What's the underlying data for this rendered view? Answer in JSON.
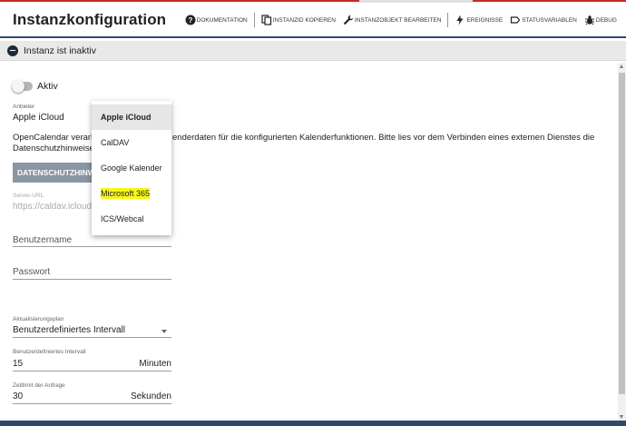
{
  "header": {
    "title": "Instanzkonfiguration",
    "toolbar": {
      "documentation": "Dokumentation",
      "copy_instance_id": "Instanzid kopieren",
      "edit_instance_object": "Instanzobjekt bearbeiten",
      "events": "Ereignisse",
      "status_variables": "Statusvariablen",
      "debug": "Debug"
    }
  },
  "section": {
    "label": "Instanz ist inaktiv"
  },
  "form": {
    "active": {
      "label": "Aktiv",
      "checked": false
    },
    "provider": {
      "label": "Anbieter",
      "value": "Apple iCloud"
    },
    "description_left": "OpenCalendar verarb",
    "description_right": "enderdaten für die konfigurierten Kalenderfunktionen. Bitte lies vor dem Verbinden eines externen Dienstes die",
    "description_line2": "Datenschutzhinweise",
    "privacy_button": "DATENSCHUTZHINW",
    "server_url": {
      "label": "Server-URL",
      "value": "https://caldav.icloud.c"
    },
    "username": {
      "placeholder": "Benutzername"
    },
    "password": {
      "placeholder": "Passwort"
    },
    "update_plan": {
      "label": "Aktualisierungsplan",
      "value": "Benutzerdefiniertes Intervall"
    },
    "custom_interval": {
      "label": "Benutzerdefiniertes Intervall",
      "value": "15",
      "unit": "Minuten"
    },
    "request_timeout": {
      "label": "Zeitlimit der Anfrage",
      "value": "30",
      "unit": "Sekunden"
    }
  },
  "dropdown": {
    "options": [
      "Apple iCloud",
      "CalDAV",
      "Google Kalender",
      "Microsoft 365",
      "ICS/Webcal"
    ],
    "selected": "Apple iCloud",
    "highlighted": "Microsoft 365"
  },
  "colors": {
    "accent_line": "#2e4a6b",
    "top_strip": "#c62828",
    "highlight": "#f7f71a",
    "button_bg": "#8a96a3"
  }
}
